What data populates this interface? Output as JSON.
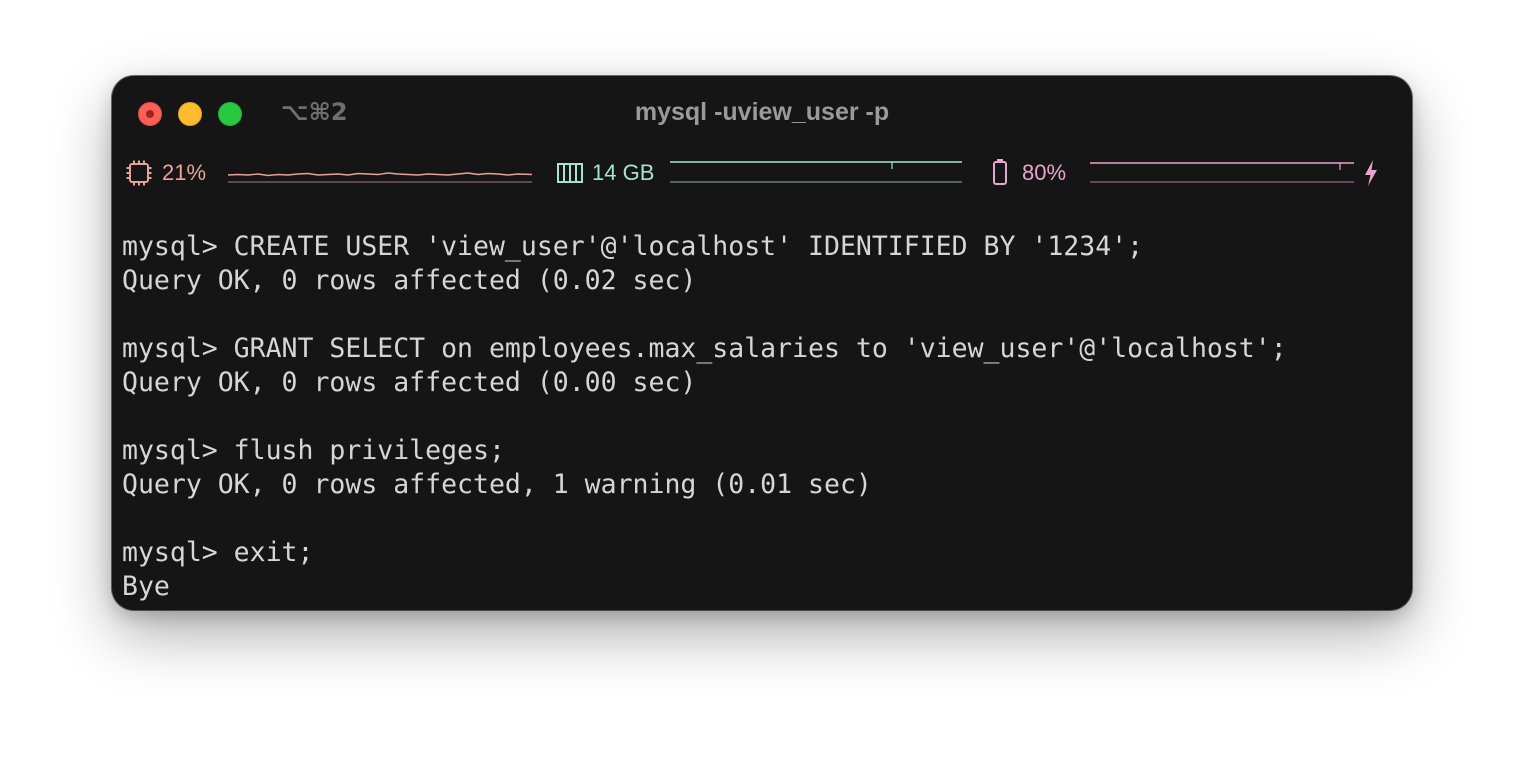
{
  "window": {
    "title": "mysql -uview_user -p",
    "shortcut": "⌥⌘2"
  },
  "status_bar": {
    "cpu": {
      "icon": "cpu-icon",
      "label": "21%",
      "color": "#e6a39b"
    },
    "memory": {
      "icon": "memory-icon",
      "label": "14 GB",
      "color": "#a6e3cf"
    },
    "battery": {
      "icon": "battery-icon",
      "label": "80%",
      "color": "#e8a6cf",
      "charging_icon": "lightning-icon"
    }
  },
  "terminal": {
    "lines": [
      "mysql> CREATE USER 'view_user'@'localhost' IDENTIFIED BY '1234';",
      "Query OK, 0 rows affected (0.02 sec)",
      "",
      "mysql> GRANT SELECT on employees.max_salaries to 'view_user'@'localhost';",
      "Query OK, 0 rows affected (0.00 sec)",
      "",
      "mysql> flush privileges;",
      "Query OK, 0 rows affected, 1 warning (0.01 sec)",
      "",
      "mysql> exit;",
      "Bye"
    ]
  },
  "colors": {
    "background": "#151515",
    "text": "#d6d6d6",
    "close": "#ff5f57",
    "minimize": "#febc2e",
    "maximize": "#28c840"
  }
}
